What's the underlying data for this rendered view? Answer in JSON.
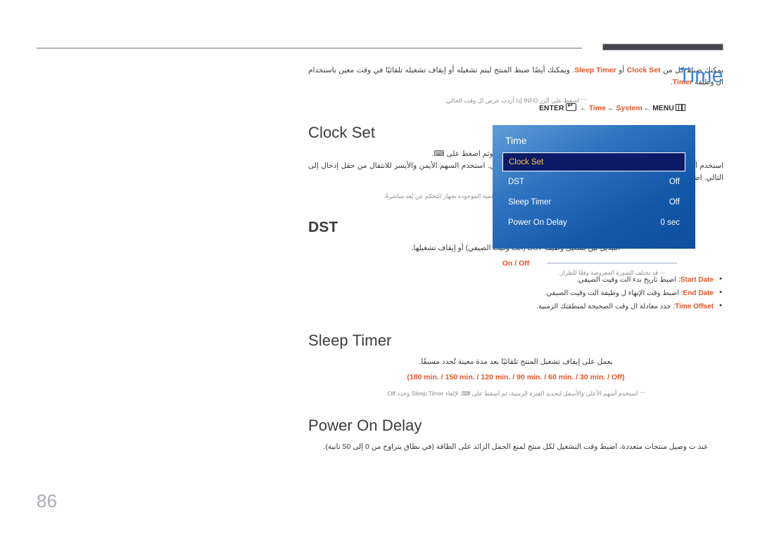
{
  "page": {
    "number": "86",
    "accent_blue": "#3f87d6",
    "accent_orange": "#e2562a",
    "osd_highlight": "#ffcc33"
  },
  "intro": {
    "before_clock_set": "يمكنك ضبط كل من ",
    "clock_set": "Clock Set",
    "between": " أو ",
    "sleep_timer": "Sleep Timer",
    "after": ". ويمكنك أيضًا ضبط المنتج ليتم تشغيله أو إيقاف تشغيله تلقائيًا في وقت معين باستخدام ال وظيفة ",
    "timer": "Timer",
    "period": ".",
    "note": "اضغط على الزر INFO إذا أردت عرض ال وقت الحالي.",
    "note_keyword": "INFO"
  },
  "sections": [
    {
      "id": "clock-set",
      "title": "Clock Set",
      "bold_title": false,
      "paragraphs": [
        "حدد Clock Set. حدد Date أو Time وثم اضغط على ⌨.",
        "استخدم أزرار الأرقام لإدخال الأرقام أو اضغط على أزرار السهم لأعلى لأسفل. استخدم السهم الأيمن والأيسر للانتقال من حقل إدخال إلى التالي. اضغط على ⌨ عند الانتهاء."
      ],
      "note": "يمكنك ضبط Date وTime عن طريق الضغط على الأزرار الرقمية الموجودة بجهاز التحكم عن بُعد مباشرةً.",
      "options": "",
      "bullets": []
    },
    {
      "id": "dst",
      "title": "DST",
      "bold_title": true,
      "paragraphs": [
        "التبديل بين تشغيل وظيفة DST (الت وقيت الصيفي) أو إيقاف تشغيلها."
      ],
      "note": "",
      "options": "On / Off",
      "bullets": [
        {
          "keyword": "Start Date",
          "text": ": اضبط تاريخ بدء الت وقيت الصيفي."
        },
        {
          "keyword": "End Date",
          "text": ": اضبط وقت الإنهاء ل وظيفة الت وقيت الصيفي."
        },
        {
          "keyword": "Time Offset",
          "text": ": حدد معادلة ال وقت الصحيحة لمنطقتك الزمنية."
        }
      ]
    },
    {
      "id": "sleep-timer",
      "title": "Sleep Timer",
      "bold_title": false,
      "paragraphs": [
        "يعمل على إيقاف تشغيل المنتج تلقائيًا بعد مدة معينة تُحدد مسبقًا."
      ],
      "note": "استخدم أسهم الأعلى والأسفل لتحديد الفترة الزمنية، ثم اضغط على ⌨. لإلغاء Sleep Timer وحدد Off.",
      "options": "(180 min. / 150 min. / 120 min. / 90 min. / 60 min. / 30 min. / Off)",
      "bullets": []
    },
    {
      "id": "power-on-delay",
      "title": "Power On Delay",
      "bold_title": false,
      "paragraphs": [
        "عند ت وصيل منتجات متعددة، اضبط وقت التشغيل لكل منتج لمنع الحمل الزائد على الطاقة (في نطاق يتراوح من 0 إلى 50 ثانية)."
      ],
      "note": "",
      "options": "",
      "bullets": []
    }
  ],
  "side": {
    "title": "Time",
    "breadcrumb": {
      "enter_label": "ENTER",
      "enter_icon": "enter-key-icon",
      "arrow": "←",
      "time": "Time",
      "system": "System",
      "menu_label": "MENU",
      "menu_icon": "menu-grid-icon"
    },
    "osd": {
      "header": "Time",
      "rows": [
        {
          "label": "Clock Set",
          "value": "",
          "selected": true
        },
        {
          "label": "DST",
          "value": "Off",
          "selected": false
        },
        {
          "label": "Sleep Timer",
          "value": "Off",
          "selected": false
        },
        {
          "label": "Power On Delay",
          "value": "0 sec",
          "selected": false
        }
      ]
    },
    "note": "قد تختلف الصورة المعروضة وفقًا للطراز."
  }
}
